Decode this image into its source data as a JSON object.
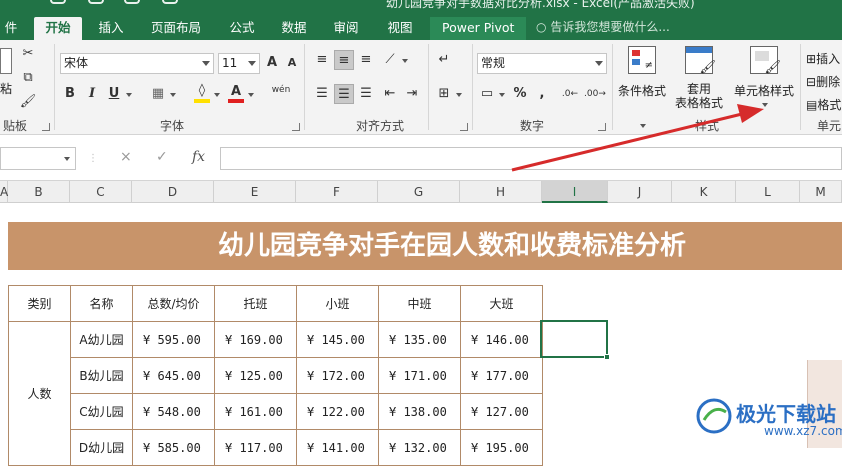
{
  "window": {
    "title": "幼儿园竞争对手数据对比分析.xlsx - Excel(产品激活失败)"
  },
  "tabs": [
    "件",
    "开始",
    "插入",
    "页面布局",
    "公式",
    "数据",
    "审阅",
    "视图",
    "Power Pivot"
  ],
  "tell_me": "告诉我您想要做什么...",
  "ribbon": {
    "paste_label": "粘",
    "clipboard_label": "贴板",
    "font_name": "宋体",
    "font_size": "11",
    "font_label": "字体",
    "align_label": "对齐方式",
    "number_format": "常规",
    "number_label": "数字",
    "styles_label": "样式",
    "cells_label": "单元",
    "cond_format": "条件格式",
    "table_format_1": "套用",
    "table_format_2": "表格格式",
    "cell_styles": "单元格样式",
    "insert": "插入",
    "delete": "删除",
    "format": "格式",
    "bold": "B",
    "italic": "I",
    "underline": "U",
    "grow_font": "A",
    "shrink_font": "A",
    "phonetic": "wén",
    "percent": "%",
    "comma": ","
  },
  "formula_bar": {
    "name_box": "",
    "cancel": "×",
    "enter": "✓",
    "fx": "fx",
    "value": ""
  },
  "columns": [
    "A",
    "B",
    "C",
    "D",
    "E",
    "F",
    "G",
    "H",
    "I",
    "J",
    "K",
    "L",
    "M"
  ],
  "sheet": {
    "banner": "幼儿园竞争对手在园人数和收费标准分析",
    "headers": [
      "类别",
      "名称",
      "总数/均价",
      "托班",
      "小班",
      "中班",
      "大班"
    ],
    "category": "人数",
    "rows": [
      [
        "A幼儿园",
        "¥  595.00",
        "¥  169.00",
        "¥  145.00",
        "¥  135.00",
        "¥  146.00"
      ],
      [
        "B幼儿园",
        "¥  645.00",
        "¥  125.00",
        "¥  172.00",
        "¥  171.00",
        "¥  177.00"
      ],
      [
        "C幼儿园",
        "¥  548.00",
        "¥  161.00",
        "¥  122.00",
        "¥  138.00",
        "¥  127.00"
      ],
      [
        "D幼儿园",
        "¥  585.00",
        "¥  117.00",
        "¥  141.00",
        "¥  132.00",
        "¥  195.00"
      ]
    ]
  },
  "watermark": {
    "text": "极光下载站",
    "url": "www.xz7.com"
  },
  "colors": {
    "excel_green": "#217346",
    "banner": "#c8946a",
    "arrow": "#d62b2b",
    "border": "#b18a68"
  }
}
